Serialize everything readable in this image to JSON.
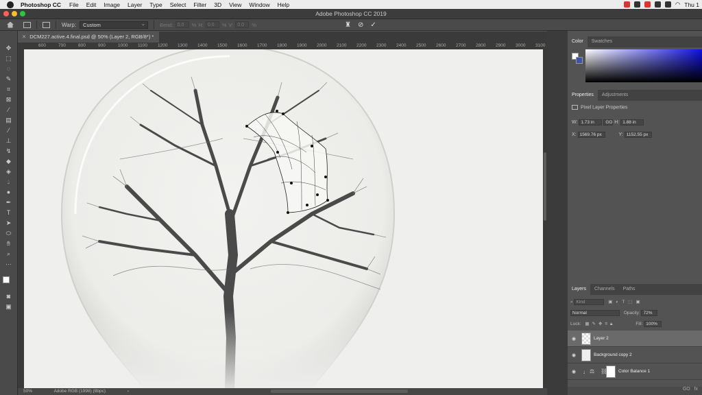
{
  "menubar": {
    "app": "Photoshop CC",
    "items": [
      "File",
      "Edit",
      "Image",
      "Layer",
      "Type",
      "Select",
      "Filter",
      "3D",
      "View",
      "Window",
      "Help"
    ],
    "clock": "Thu 1"
  },
  "window": {
    "title": "Adobe Photoshop CC 2019"
  },
  "options": {
    "warp_label": "Warp:",
    "warp_value": "Custom",
    "bend_label": "Bend:",
    "bend_value": "0.0",
    "bend_unit": "%",
    "h_label": "H:",
    "h_value": "0.0",
    "h_unit": "%",
    "v_label": "V:",
    "v_value": "0.0",
    "v_unit": "%"
  },
  "document": {
    "tab_title": "DCM227.active.4.final.psd @ 50% (Layer 2, RGB/8*) *",
    "zoom": "50%",
    "profile": "Adobe RGB (1998) (8bpc)",
    "status_arrow": "›"
  },
  "ruler": {
    "ticks": [
      "600",
      "700",
      "800",
      "900",
      "1000",
      "1100",
      "1200",
      "1300",
      "1400",
      "1500",
      "1600",
      "1700",
      "1800",
      "1900",
      "2000",
      "2100",
      "2200",
      "2300",
      "2400",
      "2500",
      "2600",
      "2700",
      "2800",
      "2900",
      "3000",
      "3100"
    ]
  },
  "panels": {
    "color_tabs": [
      "Color",
      "Swatches"
    ],
    "properties_tabs": [
      "Properties",
      "Adjustments"
    ],
    "properties_title": "Pixel Layer Properties",
    "w_label": "W:",
    "w_value": "1.73 in",
    "link_icon": "GO",
    "h_label": "H:",
    "h_value": "1.88 in",
    "x_label": "X:",
    "x_value": "1569.76 px",
    "y_label": "Y:",
    "y_value": "1152.55 px",
    "layers_tabs": [
      "Layers",
      "Channels",
      "Paths"
    ],
    "kind_label": "Kind",
    "blend_mode": "Normal",
    "opacity_label": "Opacity:",
    "opacity_value": "72%",
    "lock_label": "Lock:",
    "fill_label": "Fill:",
    "fill_value": "100%",
    "layers": [
      {
        "name": "Layer 2",
        "selected": true
      },
      {
        "name": "Background copy 2",
        "selected": false
      },
      {
        "name": "Color Balance 1",
        "selected": false
      }
    ],
    "footer_links": "GO",
    "footer_fx": "fx"
  },
  "colors": {
    "accent": "#1010e0",
    "panel_bg": "#535353",
    "canvas": "#efefed"
  }
}
